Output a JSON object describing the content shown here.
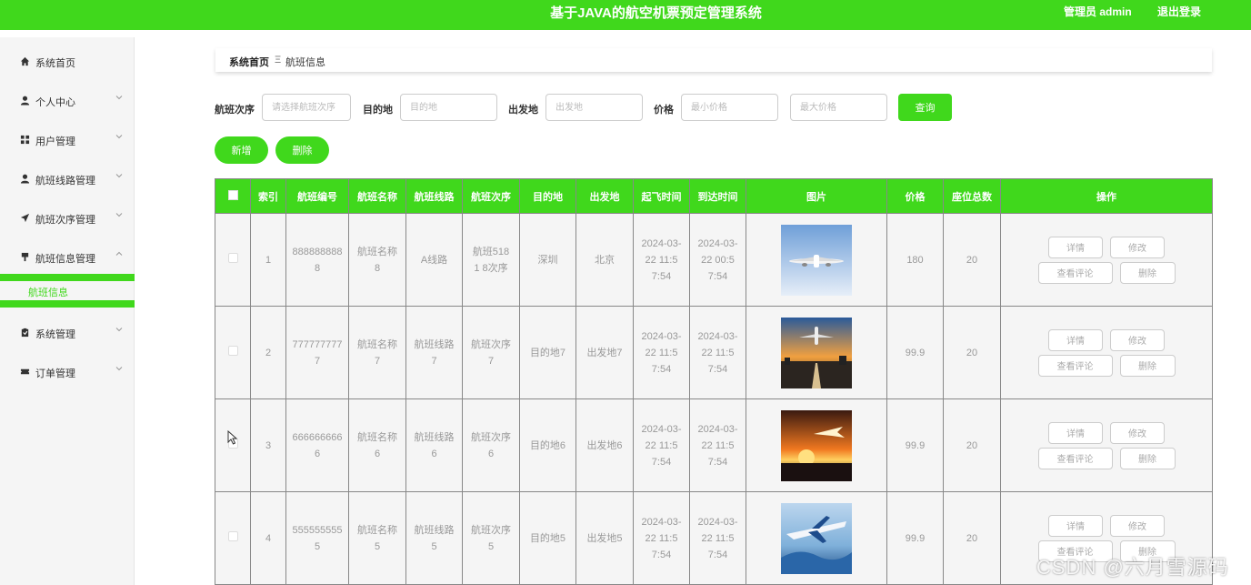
{
  "header": {
    "title": "基于JAVA的航空机票预定管理系统",
    "user": "管理员 admin",
    "logout": "退出登录"
  },
  "sidebar": {
    "items": [
      {
        "label": "系统首页",
        "icon": "home-icon"
      },
      {
        "label": "个人中心",
        "icon": "user-icon"
      },
      {
        "label": "用户管理",
        "icon": "grid-icon"
      },
      {
        "label": "航班线路管理",
        "icon": "user-icon"
      },
      {
        "label": "航班次序管理",
        "icon": "paper-plane-icon"
      },
      {
        "label": "航班信息管理",
        "icon": "pin-icon"
      },
      {
        "label": "系统管理",
        "icon": "clipboard-icon"
      },
      {
        "label": "订单管理",
        "icon": "ticket-icon"
      }
    ],
    "subitem": "航班信息"
  },
  "breadcrumb": {
    "home": "系统首页",
    "separator": "Ξ",
    "current": "航班信息"
  },
  "search": {
    "order_label": "航班次序",
    "order_placeholder": "请选择航班次序",
    "dest_label": "目的地",
    "dest_placeholder": "目的地",
    "origin_label": "出发地",
    "origin_placeholder": "出发地",
    "price_label": "价格",
    "min_placeholder": "最小价格",
    "max_placeholder": "最大价格",
    "query": "查询"
  },
  "actions": {
    "add": "新增",
    "delete": "删除"
  },
  "table": {
    "headers": [
      "索引",
      "航班编号",
      "航班名称",
      "航班线路",
      "航班次序",
      "目的地",
      "出发地",
      "起飞时间",
      "到达时间",
      "图片",
      "价格",
      "座位总数",
      "操作"
    ],
    "op_labels": {
      "detail": "详情",
      "edit": "修改",
      "comments": "查看评论",
      "delete": "删除"
    },
    "rows": [
      {
        "index": "1",
        "code": "8888888888",
        "name": "航班名称8",
        "route": "A线路",
        "order": "航班5181 8次序",
        "dest": "深圳",
        "origin": "北京",
        "depart": "2024-03-22 11:57:54",
        "arrive": "2024-03-22 00:57:54",
        "price": "180",
        "seats": "20"
      },
      {
        "index": "2",
        "code": "7777777777",
        "name": "航班名称7",
        "route": "航班线路7",
        "order": "航班次序7",
        "dest": "目的地7",
        "origin": "出发地7",
        "depart": "2024-03-22 11:57:54",
        "arrive": "2024-03-22 11:57:54",
        "price": "99.9",
        "seats": "20"
      },
      {
        "index": "3",
        "code": "6666666666",
        "name": "航班名称6",
        "route": "航班线路6",
        "order": "航班次序6",
        "dest": "目的地6",
        "origin": "出发地6",
        "depart": "2024-03-22 11:57:54",
        "arrive": "2024-03-22 11:57:54",
        "price": "99.9",
        "seats": "20"
      },
      {
        "index": "4",
        "code": "5555555555",
        "name": "航班名称5",
        "route": "航班线路5",
        "order": "航班次序5",
        "dest": "目的地5",
        "origin": "出发地5",
        "depart": "2024-03-22 11:57:54",
        "arrive": "2024-03-22 11:57:54",
        "price": "99.9",
        "seats": "20"
      }
    ]
  },
  "watermark": "CSDN @六月雪源码",
  "colors": {
    "primary": "#40d81c"
  }
}
